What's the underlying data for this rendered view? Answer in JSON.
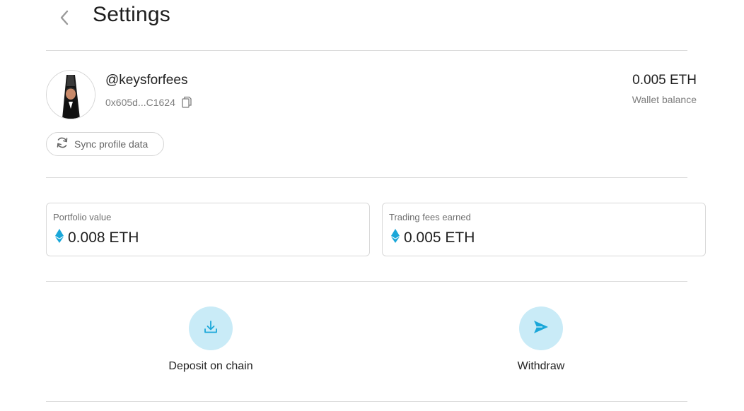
{
  "header": {
    "title": "Settings",
    "back_icon": "chevron-left-icon"
  },
  "profile": {
    "username": "@keysforfees",
    "address": "0x605d...C1624",
    "copy_icon": "copy-icon",
    "avatar_icon": "avatar-image"
  },
  "wallet": {
    "balance": "0.005 ETH",
    "label": "Wallet balance"
  },
  "sync": {
    "label": "Sync profile data",
    "icon": "refresh-icon"
  },
  "cards": [
    {
      "label": "Portfolio value",
      "value": "0.008 ETH",
      "icon": "eth-icon"
    },
    {
      "label": "Trading fees earned",
      "value": "0.005 ETH",
      "icon": "eth-icon"
    }
  ],
  "actions": {
    "deposit": {
      "label": "Deposit on chain",
      "icon": "download-icon"
    },
    "withdraw": {
      "label": "Withdraw",
      "icon": "send-icon"
    }
  },
  "colors": {
    "accent": "#1aa7d9",
    "action_bg": "#c9ebf7",
    "divider": "#dcdcdc"
  }
}
